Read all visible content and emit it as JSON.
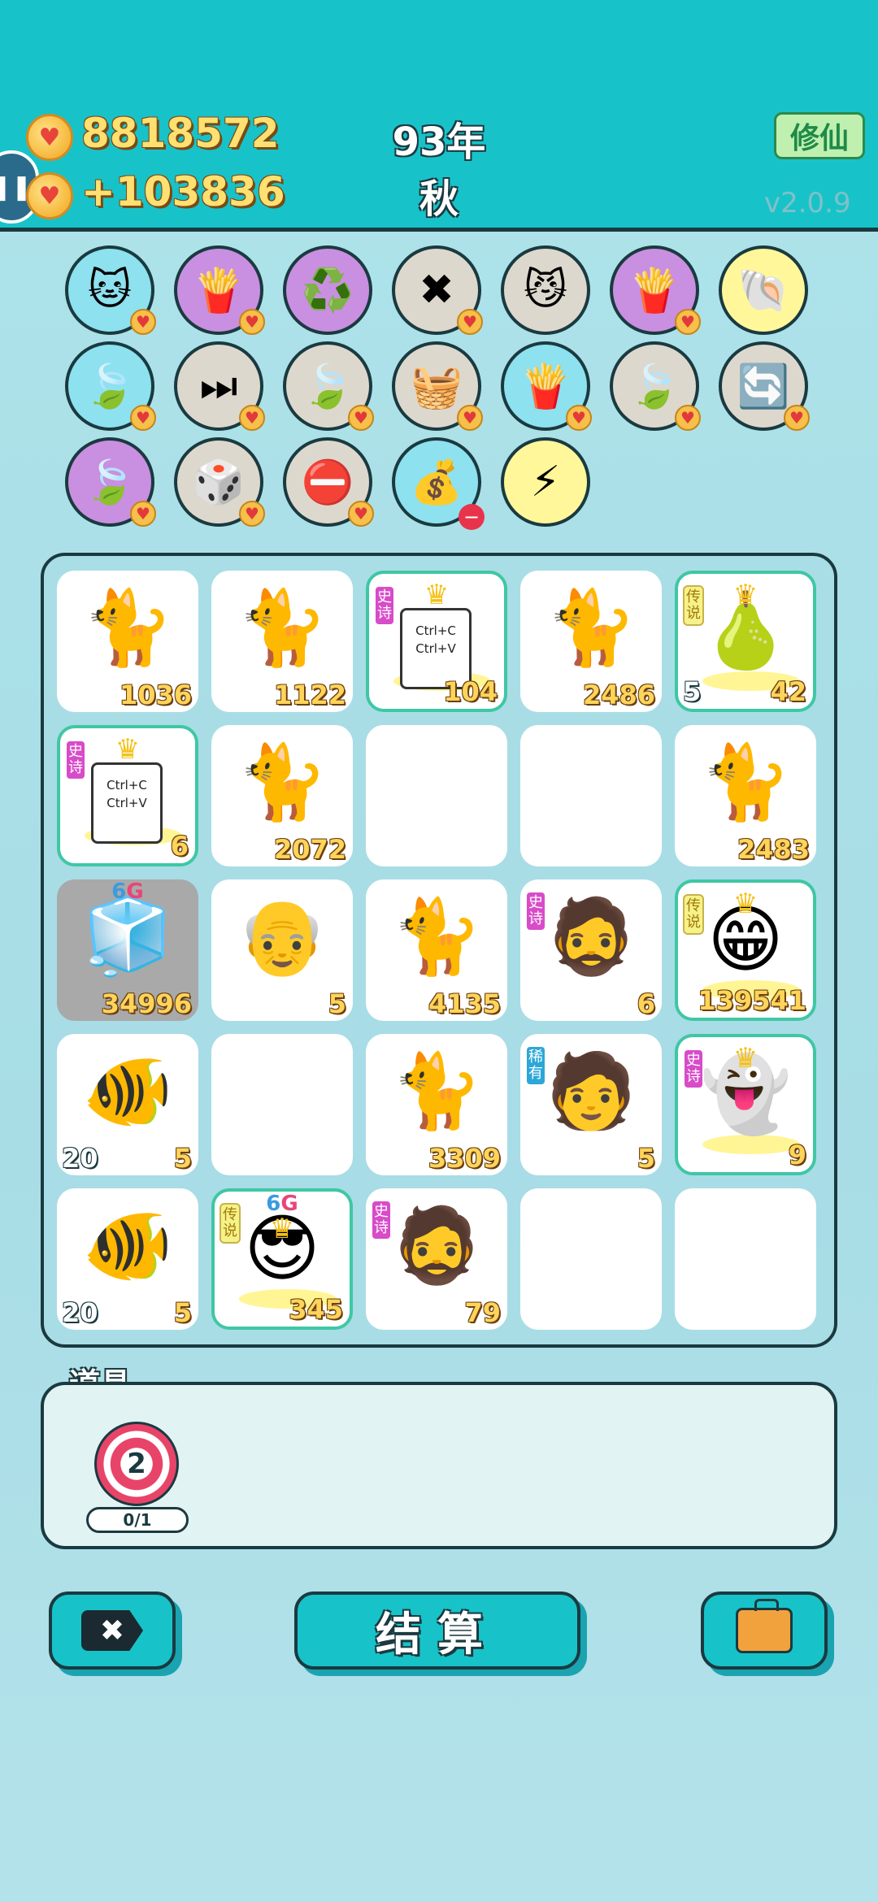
{
  "header": {
    "coins": "8818572",
    "income": "+103836",
    "year": "93年",
    "season": "秋",
    "xiuxian_label": "修仙",
    "version": "v2.0.9"
  },
  "buffs": [
    {
      "icon": "cat-icon",
      "glyph": "🐱",
      "bg": "bg-blue",
      "badge": "heart"
    },
    {
      "icon": "fries-icon",
      "glyph": "🍟",
      "bg": "bg-purple",
      "badge": "heart"
    },
    {
      "icon": "recycle-icon",
      "glyph": "♻️",
      "bg": "bg-purple",
      "badge": ""
    },
    {
      "icon": "delete-tag-icon",
      "glyph": "✖",
      "bg": "bg-gray",
      "badge": "heart"
    },
    {
      "icon": "cat-pair-icon",
      "glyph": "😼",
      "bg": "bg-gray",
      "badge": ""
    },
    {
      "icon": "fries-icon",
      "glyph": "🍟",
      "bg": "bg-purple",
      "badge": "heart"
    },
    {
      "icon": "shell-icon",
      "glyph": "🐚",
      "bg": "bg-yellow",
      "badge": ""
    },
    {
      "icon": "leaf-icon",
      "glyph": "🍃",
      "bg": "bg-blue",
      "badge": "heart"
    },
    {
      "icon": "skip-icon",
      "glyph": "⏭",
      "bg": "bg-gray",
      "badge": "heart"
    },
    {
      "icon": "leaf-icon",
      "glyph": "🍃",
      "bg": "bg-gray",
      "badge": "heart"
    },
    {
      "icon": "basket-icon",
      "glyph": "🧺",
      "bg": "bg-gray",
      "badge": "heart"
    },
    {
      "icon": "fries-icon",
      "glyph": "🍟",
      "bg": "bg-blue",
      "badge": "heart"
    },
    {
      "icon": "leaf-icon",
      "glyph": "🍃",
      "bg": "bg-gray",
      "badge": "heart"
    },
    {
      "icon": "refresh-icon",
      "glyph": "🔄",
      "bg": "bg-gray",
      "badge": "heart"
    },
    {
      "icon": "leaf-icon",
      "glyph": "🍃",
      "bg": "bg-purple",
      "badge": "heart"
    },
    {
      "icon": "dice-icon",
      "glyph": "🎲",
      "bg": "bg-gray",
      "badge": "heart"
    },
    {
      "icon": "minus-circle-icon",
      "glyph": "⛔",
      "bg": "bg-gray",
      "badge": "heart"
    },
    {
      "icon": "sack-icon",
      "glyph": "💰",
      "bg": "bg-blue",
      "badge": "stop"
    },
    {
      "icon": "lightning-icon",
      "glyph": "⚡",
      "bg": "bg-yellow",
      "badge": ""
    }
  ],
  "board": [
    {
      "icon": "cat-icon",
      "glyph": "🐈",
      "num": "1036"
    },
    {
      "icon": "cat-icon",
      "glyph": "🐈",
      "num": "1122"
    },
    {
      "icon": "copy-paste-icon",
      "kind": "copy",
      "num": "104",
      "tag": "史诗",
      "tag_type": "epic",
      "crown": true,
      "copy_text": [
        "Ctrl+C",
        "Ctrl+V"
      ]
    },
    {
      "icon": "cat-icon",
      "glyph": "🐈",
      "num": "2486"
    },
    {
      "icon": "pear-icon",
      "glyph": "🍐",
      "num": "42",
      "sub": "5",
      "tag": "传说",
      "tag_type": "legend",
      "crown": true
    },
    {
      "icon": "copy-paste-icon",
      "kind": "copy",
      "num": "6",
      "tag": "史诗",
      "tag_type": "epic",
      "crown": true,
      "copy_text": [
        "Ctrl+C",
        "Ctrl+V"
      ]
    },
    {
      "icon": "cat-icon",
      "glyph": "🐈",
      "num": "2072"
    },
    {
      "empty": true
    },
    {
      "empty": true
    },
    {
      "icon": "cat-icon",
      "glyph": "🐈",
      "num": "2483"
    },
    {
      "icon": "fridge-icon",
      "glyph": "🧊",
      "num": "34996",
      "sixg": true,
      "gray": true
    },
    {
      "icon": "old-man-icon",
      "glyph": "👴",
      "num": "5"
    },
    {
      "icon": "cat-icon",
      "glyph": "🐈",
      "num": "4135"
    },
    {
      "icon": "bearded-man-icon",
      "glyph": "🧔",
      "num": "6",
      "tag": "史诗",
      "tag_type": "epic"
    },
    {
      "icon": "grinning-elder-icon",
      "glyph": "😁",
      "num": "139541",
      "tag": "传说",
      "tag_type": "legend",
      "crown": true
    },
    {
      "icon": "fish-icon",
      "glyph": "🐠",
      "num": "5",
      "sub": "20"
    },
    {
      "empty": true
    },
    {
      "icon": "cat-icon",
      "glyph": "🐈",
      "num": "3309"
    },
    {
      "icon": "hat-man-icon",
      "glyph": "🧑",
      "num": "5",
      "tag": "稀有",
      "tag_type": "rare"
    },
    {
      "icon": "ghost-icon",
      "glyph": "👻",
      "num": "9",
      "tag": "史诗",
      "tag_type": "epic",
      "crown": true
    },
    {
      "icon": "fish-icon",
      "glyph": "🐠",
      "num": "5",
      "sub": "20"
    },
    {
      "icon": "sunglasses-man-icon",
      "glyph": "😎",
      "num": "345",
      "tag": "传说",
      "tag_type": "legend",
      "crown": true,
      "sixg": true
    },
    {
      "icon": "bearded-man-icon",
      "glyph": "🧔",
      "num": "79",
      "tag": "史诗",
      "tag_type": "epic"
    },
    {
      "empty": true
    },
    {
      "empty": true
    }
  ],
  "sixg_label": {
    "six": "6",
    "g": "G"
  },
  "props": {
    "title": "道具",
    "target_count": "2",
    "counter": "0/1"
  },
  "buttons": {
    "close_glyph": "✖",
    "settle_label": "结算"
  },
  "colors": {
    "header_bg": "#17c3c9",
    "coin_text": "#ffe070",
    "epic": "#d84bc9",
    "legend": "#f6f28a",
    "rare": "#2ba7d8"
  }
}
